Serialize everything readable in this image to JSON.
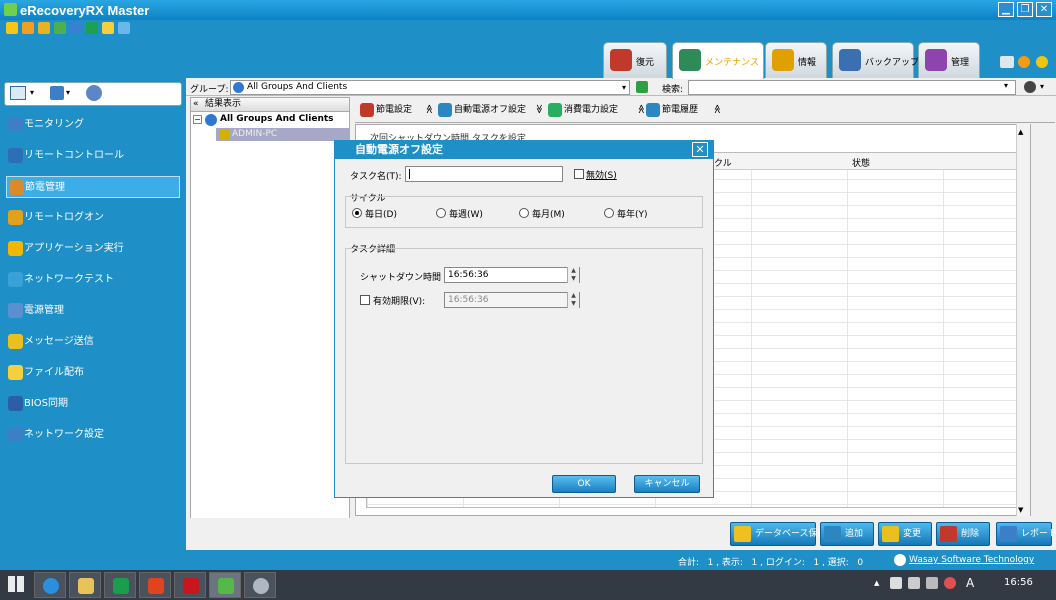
{
  "app": {
    "title": "eRecoveryRX Master"
  },
  "window_controls": {
    "minimize": "▁",
    "restore": "❐",
    "close": "✕"
  },
  "main_tabs": [
    {
      "label": "復元",
      "icon": "restore-icon",
      "color": "#c0392b"
    },
    {
      "label": "メンテナンス",
      "icon": "maintenance-icon",
      "color": "#2e8b57",
      "active": true
    },
    {
      "label": "情報",
      "icon": "info-icon",
      "color": "#e0a000"
    },
    {
      "label": "バックアップ",
      "icon": "backup-icon",
      "color": "#3a6fb0"
    },
    {
      "label": "管理",
      "icon": "admin-icon",
      "color": "#8e44ad"
    }
  ],
  "sidebar": {
    "items": [
      {
        "label": "モニタリング",
        "icon": "monitor-icon"
      },
      {
        "label": "リモートコントロール",
        "icon": "remote-control-icon"
      },
      {
        "label": "節電管理",
        "icon": "power-saving-icon",
        "selected": true
      },
      {
        "label": "リモートログオン",
        "icon": "remote-logon-icon"
      },
      {
        "label": "アプリケーション実行",
        "icon": "app-run-icon"
      },
      {
        "label": "ネットワークテスト",
        "icon": "network-test-icon"
      },
      {
        "label": "電源管理",
        "icon": "power-icon"
      },
      {
        "label": "メッセージ送信",
        "icon": "message-icon"
      },
      {
        "label": "ファイル配布",
        "icon": "file-icon"
      },
      {
        "label": "BIOS同期",
        "icon": "bios-icon"
      },
      {
        "label": "ネットワーク設定",
        "icon": "network-settings-icon"
      }
    ]
  },
  "group_bar": {
    "group_label": "グループ:",
    "group_value": "All Groups And Clients",
    "search_label": "検索:",
    "search_value": ""
  },
  "tree": {
    "header": "結果表示",
    "collapse_glyph": "«",
    "root": "All Groups And Clients",
    "child": "ADMIN-PC"
  },
  "sub_tabs": [
    "節電設定",
    "自動電源オフ設定",
    "消費電力設定",
    "節電履歴"
  ],
  "content": {
    "partial_text": "次回シャットダウン時間 タスクを設定",
    "columns": [
      "クル",
      "状態"
    ]
  },
  "action_buttons": [
    "データベース保存",
    "追加",
    "変更",
    "削除",
    "レポート"
  ],
  "status": {
    "summary": "合計:   1 , 表示:   1 , ログイン:   1 , 選択:   0",
    "company": "Wasay Software Technology"
  },
  "clock": "16:56",
  "ime": "A",
  "dialog": {
    "title": "自動電源オフ設定",
    "close": "✕",
    "task_name_label": "タスク名(T):",
    "task_name_value": "",
    "disable_label": "無効(S)",
    "cycle_label": "サイクル",
    "cycles": [
      "毎日(D)",
      "毎週(W)",
      "毎月(M)",
      "毎年(Y)"
    ],
    "cycle_selected": 0,
    "detail_label": "タスク詳細",
    "shutdown_label": "シャットダウン時間",
    "shutdown_value": "16:56:36",
    "expire_label": "有効期限(V):",
    "expire_value": "16:56:36",
    "ok": "OK",
    "cancel": "キャンセル"
  }
}
